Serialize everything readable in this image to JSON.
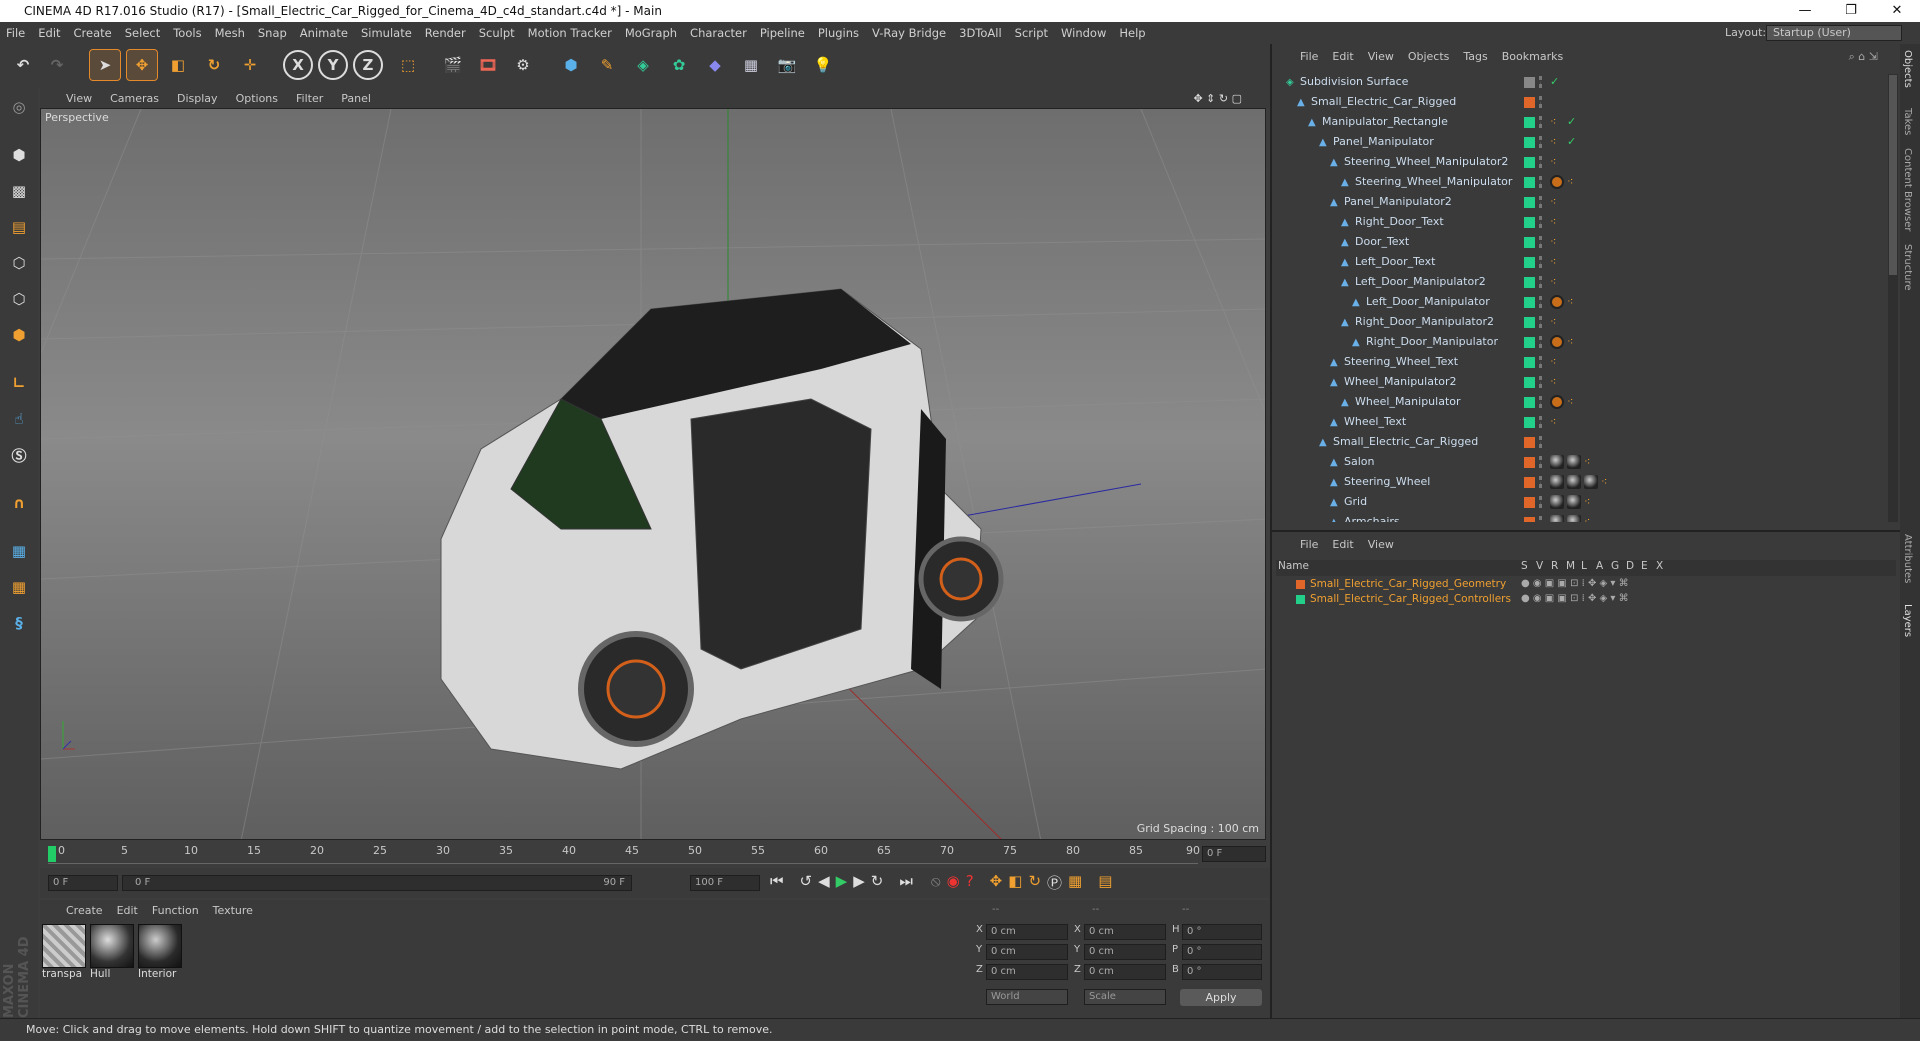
{
  "window": {
    "title": "CINEMA 4D R17.016 Studio (R17) - [Small_Electric_Car_Rigged_for_Cinema_4D_c4d_standart.c4d *] - Main",
    "min": "—",
    "max": "❐",
    "close": "✕"
  },
  "menubar": [
    "File",
    "Edit",
    "Create",
    "Select",
    "Tools",
    "Mesh",
    "Snap",
    "Animate",
    "Simulate",
    "Render",
    "Sculpt",
    "Motion Tracker",
    "MoGraph",
    "Character",
    "Pipeline",
    "Plugins",
    "V-Ray Bridge",
    "3DToAll",
    "Script",
    "Window",
    "Help"
  ],
  "layout": {
    "label": "Layout:",
    "value": "Startup (User)"
  },
  "toolbar": {
    "x": "X",
    "y": "Y",
    "z": "Z"
  },
  "viewport": {
    "menu": [
      "View",
      "Cameras",
      "Display",
      "Options",
      "Filter",
      "Panel"
    ],
    "label": "Perspective",
    "grid": "Grid Spacing : 100 cm"
  },
  "timeline": {
    "ticks": [
      "0",
      "5",
      "10",
      "15",
      "20",
      "25",
      "30",
      "35",
      "40",
      "45",
      "50",
      "55",
      "60",
      "65",
      "70",
      "75",
      "80",
      "85",
      "90"
    ],
    "current": "0 F"
  },
  "transport": {
    "start": "0 F",
    "range_start": "0 F",
    "range_end": "90 F",
    "end": "100 F"
  },
  "materials": {
    "menu": [
      "Create",
      "Edit",
      "Function",
      "Texture"
    ],
    "items": [
      "transpa",
      "Hull",
      "Interior"
    ]
  },
  "coords": {
    "headers": [
      "--",
      "--",
      "--"
    ],
    "rows": [
      {
        "a": "X",
        "av": "0 cm",
        "b": "X",
        "bv": "0 cm",
        "c": "H",
        "cv": "0 °"
      },
      {
        "a": "Y",
        "av": "0 cm",
        "b": "Y",
        "bv": "0 cm",
        "c": "P",
        "cv": "0 °"
      },
      {
        "a": "Z",
        "av": "0 cm",
        "b": "Z",
        "bv": "0 cm",
        "c": "B",
        "cv": "0 °"
      }
    ],
    "mode1": "World",
    "mode2": "Scale",
    "apply": "Apply"
  },
  "objects": {
    "menu": [
      "File",
      "Edit",
      "View",
      "Objects",
      "Tags",
      "Bookmarks"
    ],
    "rows": [
      {
        "name": "Subdivision Surface",
        "swatch": "#888888"
      },
      {
        "name": "Small_Electric_Car_Rigged",
        "swatch": "#e0662a"
      },
      {
        "name": "Manipulator_Rectangle",
        "swatch": "#22d08a"
      },
      {
        "name": "Panel_Manipulator",
        "swatch": "#22d08a"
      },
      {
        "name": "Steering_Wheel_Manipulator2",
        "swatch": "#22d08a"
      },
      {
        "name": "Steering_Wheel_Manipulator",
        "swatch": "#22d08a"
      },
      {
        "name": "Panel_Manipulator2",
        "swatch": "#22d08a"
      },
      {
        "name": "Right_Door_Text",
        "swatch": "#22d08a"
      },
      {
        "name": "Door_Text",
        "swatch": "#22d08a"
      },
      {
        "name": "Left_Door_Text",
        "swatch": "#22d08a"
      },
      {
        "name": "Left_Door_Manipulator2",
        "swatch": "#22d08a"
      },
      {
        "name": "Left_Door_Manipulator",
        "swatch": "#22d08a"
      },
      {
        "name": "Right_Door_Manipulator2",
        "swatch": "#22d08a"
      },
      {
        "name": "Right_Door_Manipulator",
        "swatch": "#22d08a"
      },
      {
        "name": "Steering_Wheel_Text",
        "swatch": "#22d08a"
      },
      {
        "name": "Wheel_Manipulator2",
        "swatch": "#22d08a"
      },
      {
        "name": "Wheel_Manipulator",
        "swatch": "#22d08a"
      },
      {
        "name": "Wheel_Text",
        "swatch": "#22d08a"
      },
      {
        "name": "Small_Electric_Car_Rigged",
        "swatch": "#e0662a"
      },
      {
        "name": "Salon",
        "swatch": "#e0662a"
      },
      {
        "name": "Steering_Wheel",
        "swatch": "#e0662a"
      },
      {
        "name": "Grid",
        "swatch": "#e0662a"
      },
      {
        "name": "Armchairs",
        "swatch": "#e0662a"
      }
    ]
  },
  "layers": {
    "menu": [
      "File",
      "Edit",
      "View"
    ],
    "cols": [
      "Name",
      "S",
      "V",
      "R",
      "M",
      "L",
      "A",
      "G",
      "D",
      "E",
      "X"
    ],
    "rows": [
      {
        "name": "Small_Electric_Car_Rigged_Geometry",
        "color": "#e0662a"
      },
      {
        "name": "Small_Electric_Car_Rigged_Controllers",
        "color": "#22d08a"
      }
    ]
  },
  "sidetabs": [
    "Objects",
    "Takes",
    "Content Browser",
    "Structure",
    "Attributes",
    "Layers"
  ],
  "brand": "MAXON CINEMA 4D",
  "status": "Move: Click and drag to move elements. Hold down SHIFT to quantize movement / add to the selection in point mode, CTRL to remove."
}
